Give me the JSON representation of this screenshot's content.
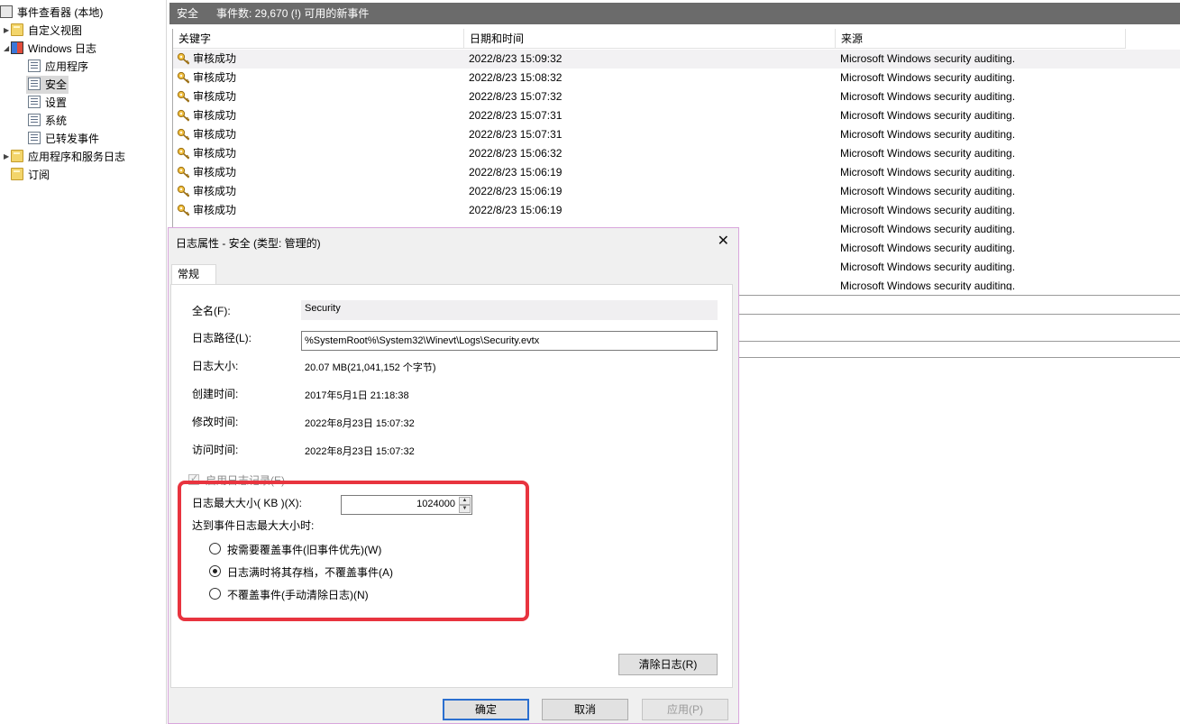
{
  "tree": {
    "items": [
      {
        "label": "事件查看器 (本地)",
        "icon": "event-viewer-icon"
      },
      {
        "label": "自定义视图",
        "icon": "folder-icon"
      },
      {
        "label": "Windows 日志",
        "icon": "windows-log-icon"
      },
      {
        "label": "应用程序",
        "icon": "log-icon"
      },
      {
        "label": "安全",
        "icon": "log-icon"
      },
      {
        "label": "设置",
        "icon": "log-icon"
      },
      {
        "label": "系统",
        "icon": "log-icon"
      },
      {
        "label": "已转发事件",
        "icon": "log-icon"
      },
      {
        "label": "应用程序和服务日志",
        "icon": "folder-icon"
      },
      {
        "label": "订阅",
        "icon": "folder-icon"
      }
    ],
    "selected": "安全"
  },
  "panel": {
    "title": "安全",
    "count_text": "事件数: 29,670 (!) 可用的新事件"
  },
  "grid": {
    "columns": [
      "关键字",
      "日期和时间",
      "来源"
    ],
    "rows": [
      {
        "keyword": "审核成功",
        "datetime": "2022/8/23 15:09:32",
        "source": "Microsoft Windows security auditing."
      },
      {
        "keyword": "审核成功",
        "datetime": "2022/8/23 15:08:32",
        "source": "Microsoft Windows security auditing."
      },
      {
        "keyword": "审核成功",
        "datetime": "2022/8/23 15:07:32",
        "source": "Microsoft Windows security auditing."
      },
      {
        "keyword": "审核成功",
        "datetime": "2022/8/23 15:07:31",
        "source": "Microsoft Windows security auditing."
      },
      {
        "keyword": "审核成功",
        "datetime": "2022/8/23 15:07:31",
        "source": "Microsoft Windows security auditing."
      },
      {
        "keyword": "审核成功",
        "datetime": "2022/8/23 15:06:32",
        "source": "Microsoft Windows security auditing."
      },
      {
        "keyword": "审核成功",
        "datetime": "2022/8/23 15:06:19",
        "source": "Microsoft Windows security auditing."
      },
      {
        "keyword": "审核成功",
        "datetime": "2022/8/23 15:06:19",
        "source": "Microsoft Windows security auditing."
      },
      {
        "keyword": "审核成功",
        "datetime": "2022/8/23 15:06:19",
        "source": "Microsoft Windows security auditing."
      }
    ],
    "hidden_rows_sources": [
      "Microsoft Windows security auditing.",
      "Microsoft Windows security auditing.",
      "Microsoft Windows security auditing.",
      "Microsoft Windows security auditing."
    ]
  },
  "dialog": {
    "title": "日志属性 - 安全 (类型: 管理的)",
    "close": "✕",
    "tab": "常规",
    "fullname_label": "全名(F):",
    "fullname_value": "Security",
    "path_label": "日志路径(L):",
    "path_value": "%SystemRoot%\\System32\\Winevt\\Logs\\Security.evtx",
    "size_label": "日志大小:",
    "size_value": "20.07 MB(21,041,152 个字节)",
    "created_label": "创建时间:",
    "created_value": "2017年5月1日 21:18:38",
    "modified_label": "修改时间:",
    "modified_value": "2022年8月23日 15:07:32",
    "accessed_label": "访问时间:",
    "accessed_value": "2022年8月23日 15:07:32",
    "enable_logging_label": "启用日志记录(E)",
    "max_size_label": "日志最大大小( KB )(X):",
    "max_size_value": "1024000",
    "when_max_label": "达到事件日志最大大小时:",
    "options": [
      {
        "label": "按需要覆盖事件(旧事件优先)(W)",
        "selected": false
      },
      {
        "label": "日志满时将其存档，不覆盖事件(A)",
        "selected": true
      },
      {
        "label": "不覆盖事件(手动清除日志)(N)",
        "selected": false
      }
    ],
    "clear_button": "清除日志(R)",
    "ok_button": "确定",
    "cancel_button": "取消",
    "apply_button": "应用(P)"
  },
  "colors": {
    "highlight": "#e8343f",
    "header_bg": "#6b6b6b",
    "default_button_border": "#2b6fcf"
  }
}
